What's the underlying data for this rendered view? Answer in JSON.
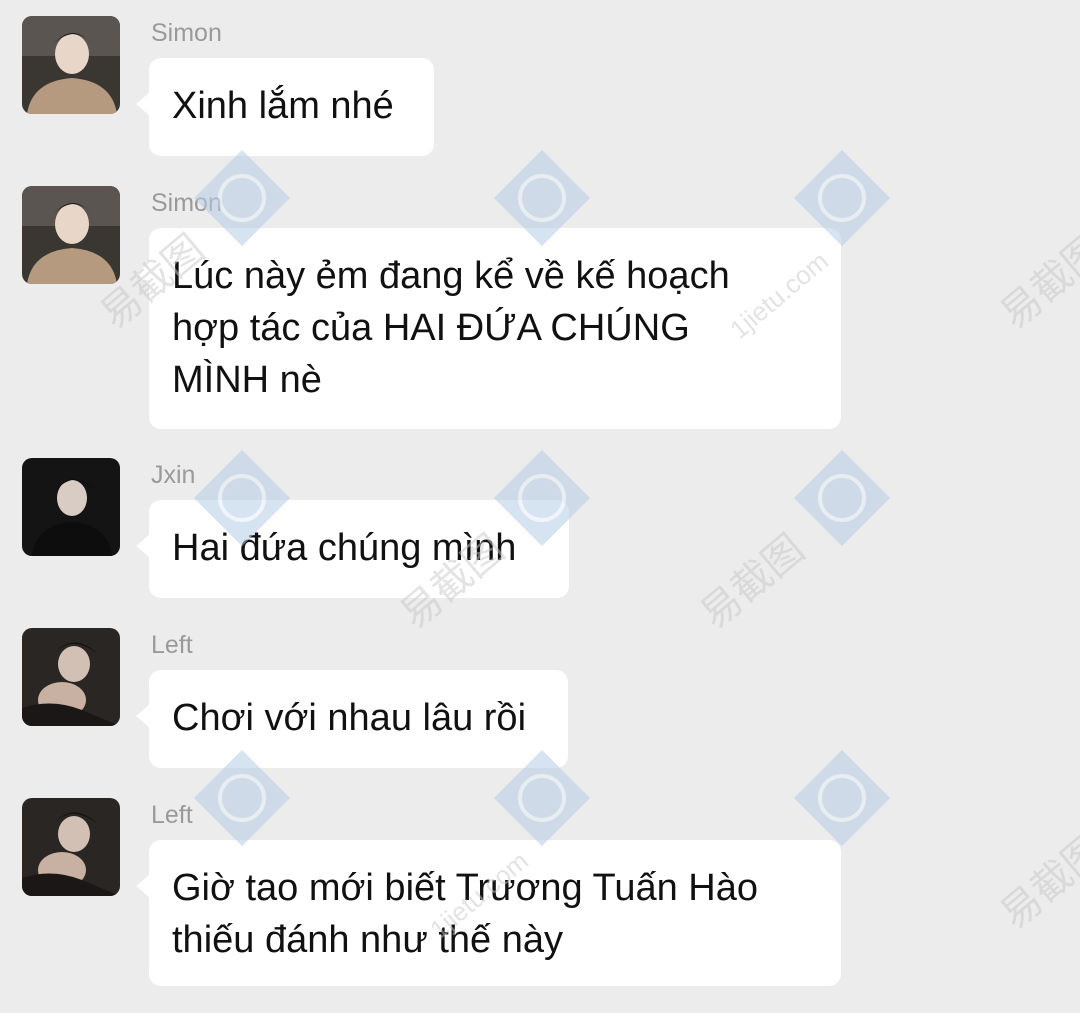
{
  "messages": [
    {
      "sender": "Simon",
      "avatar": "simon-avatar",
      "text": "Xinh lắm nhé"
    },
    {
      "sender": "Simon",
      "avatar": "simon-avatar",
      "text": "Lúc này ẻm đang kể về kế hoạch\nhợp tác của HAI ĐỨA CHÚNG\nMÌNH nè"
    },
    {
      "sender": "Jxin",
      "avatar": "jxin-avatar",
      "text": "Hai đứa chúng mình"
    },
    {
      "sender": "Left",
      "avatar": "left-avatar",
      "text": "Chơi với nhau lâu rồi"
    },
    {
      "sender": "Left",
      "avatar": "left-avatar",
      "text": "Giờ tao mới biết Trương Tuấn Hào\nthiếu đánh như thế này"
    }
  ],
  "watermark": {
    "brand": "易截图",
    "site": "1jietu.com"
  }
}
